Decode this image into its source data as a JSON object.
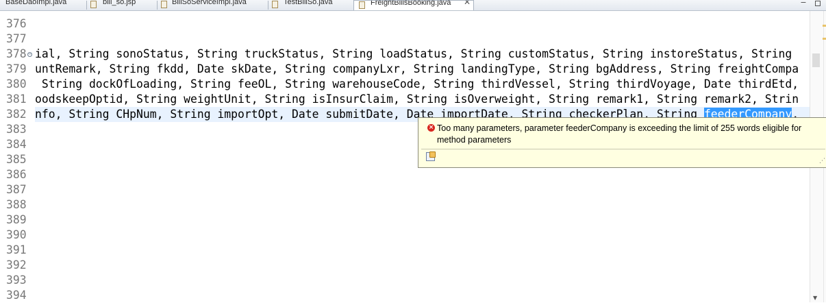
{
  "tabs": [
    {
      "label": "BaseDaoImpl.java",
      "active": false,
      "icon": "java-file-icon"
    },
    {
      "label": "bill_so.jsp",
      "active": false,
      "icon": "jsp-file-icon"
    },
    {
      "label": "BillSoServiceImpl.java",
      "active": false,
      "icon": "java-file-icon"
    },
    {
      "label": "TestBillSo.java",
      "active": false,
      "icon": "java-file-icon"
    },
    {
      "label": "FreightBillsBooking.java",
      "active": true,
      "icon": "java-file-icon",
      "close": "✕"
    }
  ],
  "window_controls": {
    "minimize": "−",
    "maximize": "□"
  },
  "editor": {
    "lines": [
      {
        "num": "376",
        "code": ""
      },
      {
        "num": "377",
        "code": ""
      },
      {
        "num": "378",
        "code": "ial, String sonoStatus, String truckStatus, String loadStatus, String customStatus, String instoreStatus, String ",
        "fold": "−"
      },
      {
        "num": "379",
        "code": "untRemark, String fkdd, Date skDate, String companyLxr, String landingType, String bgAddress, String freightCompa"
      },
      {
        "num": "380",
        "code": " String dockOfLoading, String feeOL, String warehouseCode, String thirdVessel, String thirdVoyage, Date thirdEtd,"
      },
      {
        "num": "381",
        "code": "oodskeepOptid, String weightUnit, String isInsurClaim, String isOverweight, String remark1, String remark2, Strin"
      },
      {
        "num": "382",
        "code_before": "nfo, String CHpNum, String importOpt, Date submitDate, Date importDate, String checkerPlan, String ",
        "selected": "feederCompany",
        "code_after": ",",
        "current": true
      },
      {
        "num": "383",
        "code": ""
      },
      {
        "num": "384",
        "code": ""
      },
      {
        "num": "385",
        "code": ""
      },
      {
        "num": "386",
        "code": ""
      },
      {
        "num": "387",
        "code": ""
      },
      {
        "num": "388",
        "code": ""
      },
      {
        "num": "389",
        "code": ""
      },
      {
        "num": "390",
        "code": ""
      },
      {
        "num": "391",
        "code": ""
      },
      {
        "num": "392",
        "code": ""
      },
      {
        "num": "393",
        "code": ""
      },
      {
        "num": "394",
        "code": ""
      }
    ]
  },
  "problem_hover": {
    "icon": "error-icon",
    "message_line1": "Too many parameters, parameter feederCompany is exceeding the limit of 255 words eligible for",
    "message_line2": "method parameters",
    "quick_fix_icon": "quick-fix-icon"
  },
  "colors": {
    "selection": "#3399ff",
    "current_line": "#e8f2fe",
    "hover_background": "#ffffe1",
    "error": "#d8261f",
    "line_number": "#787878"
  }
}
